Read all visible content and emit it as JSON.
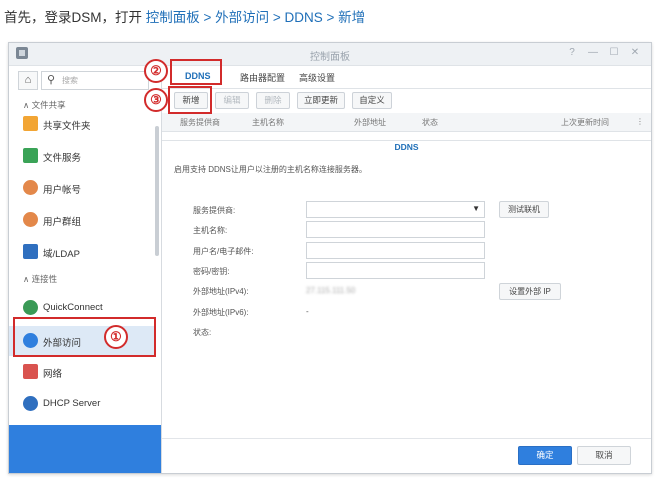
{
  "instruction": {
    "prefix": "首先，登录DSM，打开 ",
    "path": "控制面板 > 外部访问 > DDNS > 新增"
  },
  "window": {
    "title": "控制面板",
    "controls": [
      "?",
      "—",
      "☐",
      "✕"
    ]
  },
  "sidebar": {
    "search_placeholder": "搜索",
    "section_file": "文件共享",
    "section_conn": "连接性",
    "items": [
      {
        "label": "共享文件夹",
        "icon": "folder-share-icon",
        "color": "#f2a534"
      },
      {
        "label": "文件服务",
        "icon": "file-services-icon",
        "color": "#3aa357"
      },
      {
        "label": "用户帐号",
        "icon": "user-icon",
        "color": "#e3884a"
      },
      {
        "label": "用户群组",
        "icon": "group-icon",
        "color": "#e3884a"
      },
      {
        "label": "域/LDAP",
        "icon": "domain-ldap-icon",
        "color": "#2f6fbf"
      },
      {
        "label": "QuickConnect",
        "icon": "quickconnect-icon",
        "color": "#3a9a56"
      },
      {
        "label": "外部访问",
        "icon": "globe-icon",
        "color": "#2f7fde"
      },
      {
        "label": "网络",
        "icon": "network-house-icon",
        "color": "#d9534f"
      },
      {
        "label": "DHCP Server",
        "icon": "dhcp-icon",
        "color": "#2f6fbf"
      }
    ]
  },
  "tabs": [
    "DDNS",
    "路由器配置",
    "高级设置"
  ],
  "toolbar": {
    "add": "新增",
    "edit": "编辑",
    "delete": "删除",
    "update_now": "立即更新",
    "customize": "自定义"
  },
  "table_headers": [
    "服务提供商",
    "主机名称",
    "外部地址",
    "状态",
    "上次更新时间"
  ],
  "dialog": {
    "title": "DDNS",
    "description": "启用支持 DDNS让用户以注册的主机名称连接服务器。",
    "fields": {
      "provider": "服务提供商:",
      "hostname": "主机名称:",
      "username": "用户名/电子邮件:",
      "password": "密码/密钥:",
      "ipv4": "外部地址(IPv4):",
      "ipv6": "外部地址(IPv6):",
      "status": "状态:"
    },
    "ipv4_value": "27.115.111.50",
    "ipv6_value": "-",
    "test_button": "测试联机",
    "set_external_ip_button": "设置外部 IP",
    "ok": "确定",
    "cancel": "取消"
  },
  "callouts": [
    "①",
    "②",
    "③"
  ],
  "colors": {
    "accent": "#2f7fde",
    "callout": "#d22b2b"
  }
}
